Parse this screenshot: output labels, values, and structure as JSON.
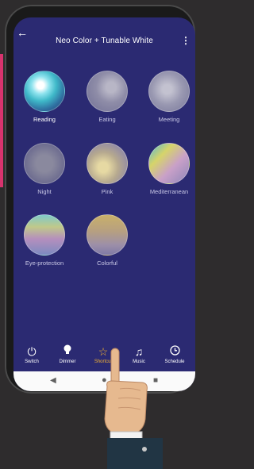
{
  "header": {
    "back_icon": "arrow-left-icon",
    "title": "Neo Color + Tunable White",
    "more_icon": "more-vert-icon"
  },
  "scenes": [
    {
      "label": "Reading",
      "active": true
    },
    {
      "label": "Eating"
    },
    {
      "label": "Meeting"
    },
    {
      "label": "Night"
    },
    {
      "label": "Pink"
    },
    {
      "label": "Mediterranean"
    },
    {
      "label": "Eye-protection"
    },
    {
      "label": "Colorful"
    }
  ],
  "tabs": [
    {
      "label": "Switch",
      "icon": "power-icon"
    },
    {
      "label": "Dimmer",
      "icon": "bulb-icon"
    },
    {
      "label": "Shortcut",
      "icon": "star-icon",
      "selected": true
    },
    {
      "label": "Music",
      "icon": "music-note-icon"
    },
    {
      "label": "Schedule",
      "icon": "clock-icon"
    }
  ],
  "system_nav": [
    "back-triangle-icon",
    "home-circle-icon",
    "recents-square-icon"
  ],
  "colors": {
    "screen_bg": "#2b2a72",
    "accent_selected": "#f2b233",
    "strip": "#d8336e"
  }
}
